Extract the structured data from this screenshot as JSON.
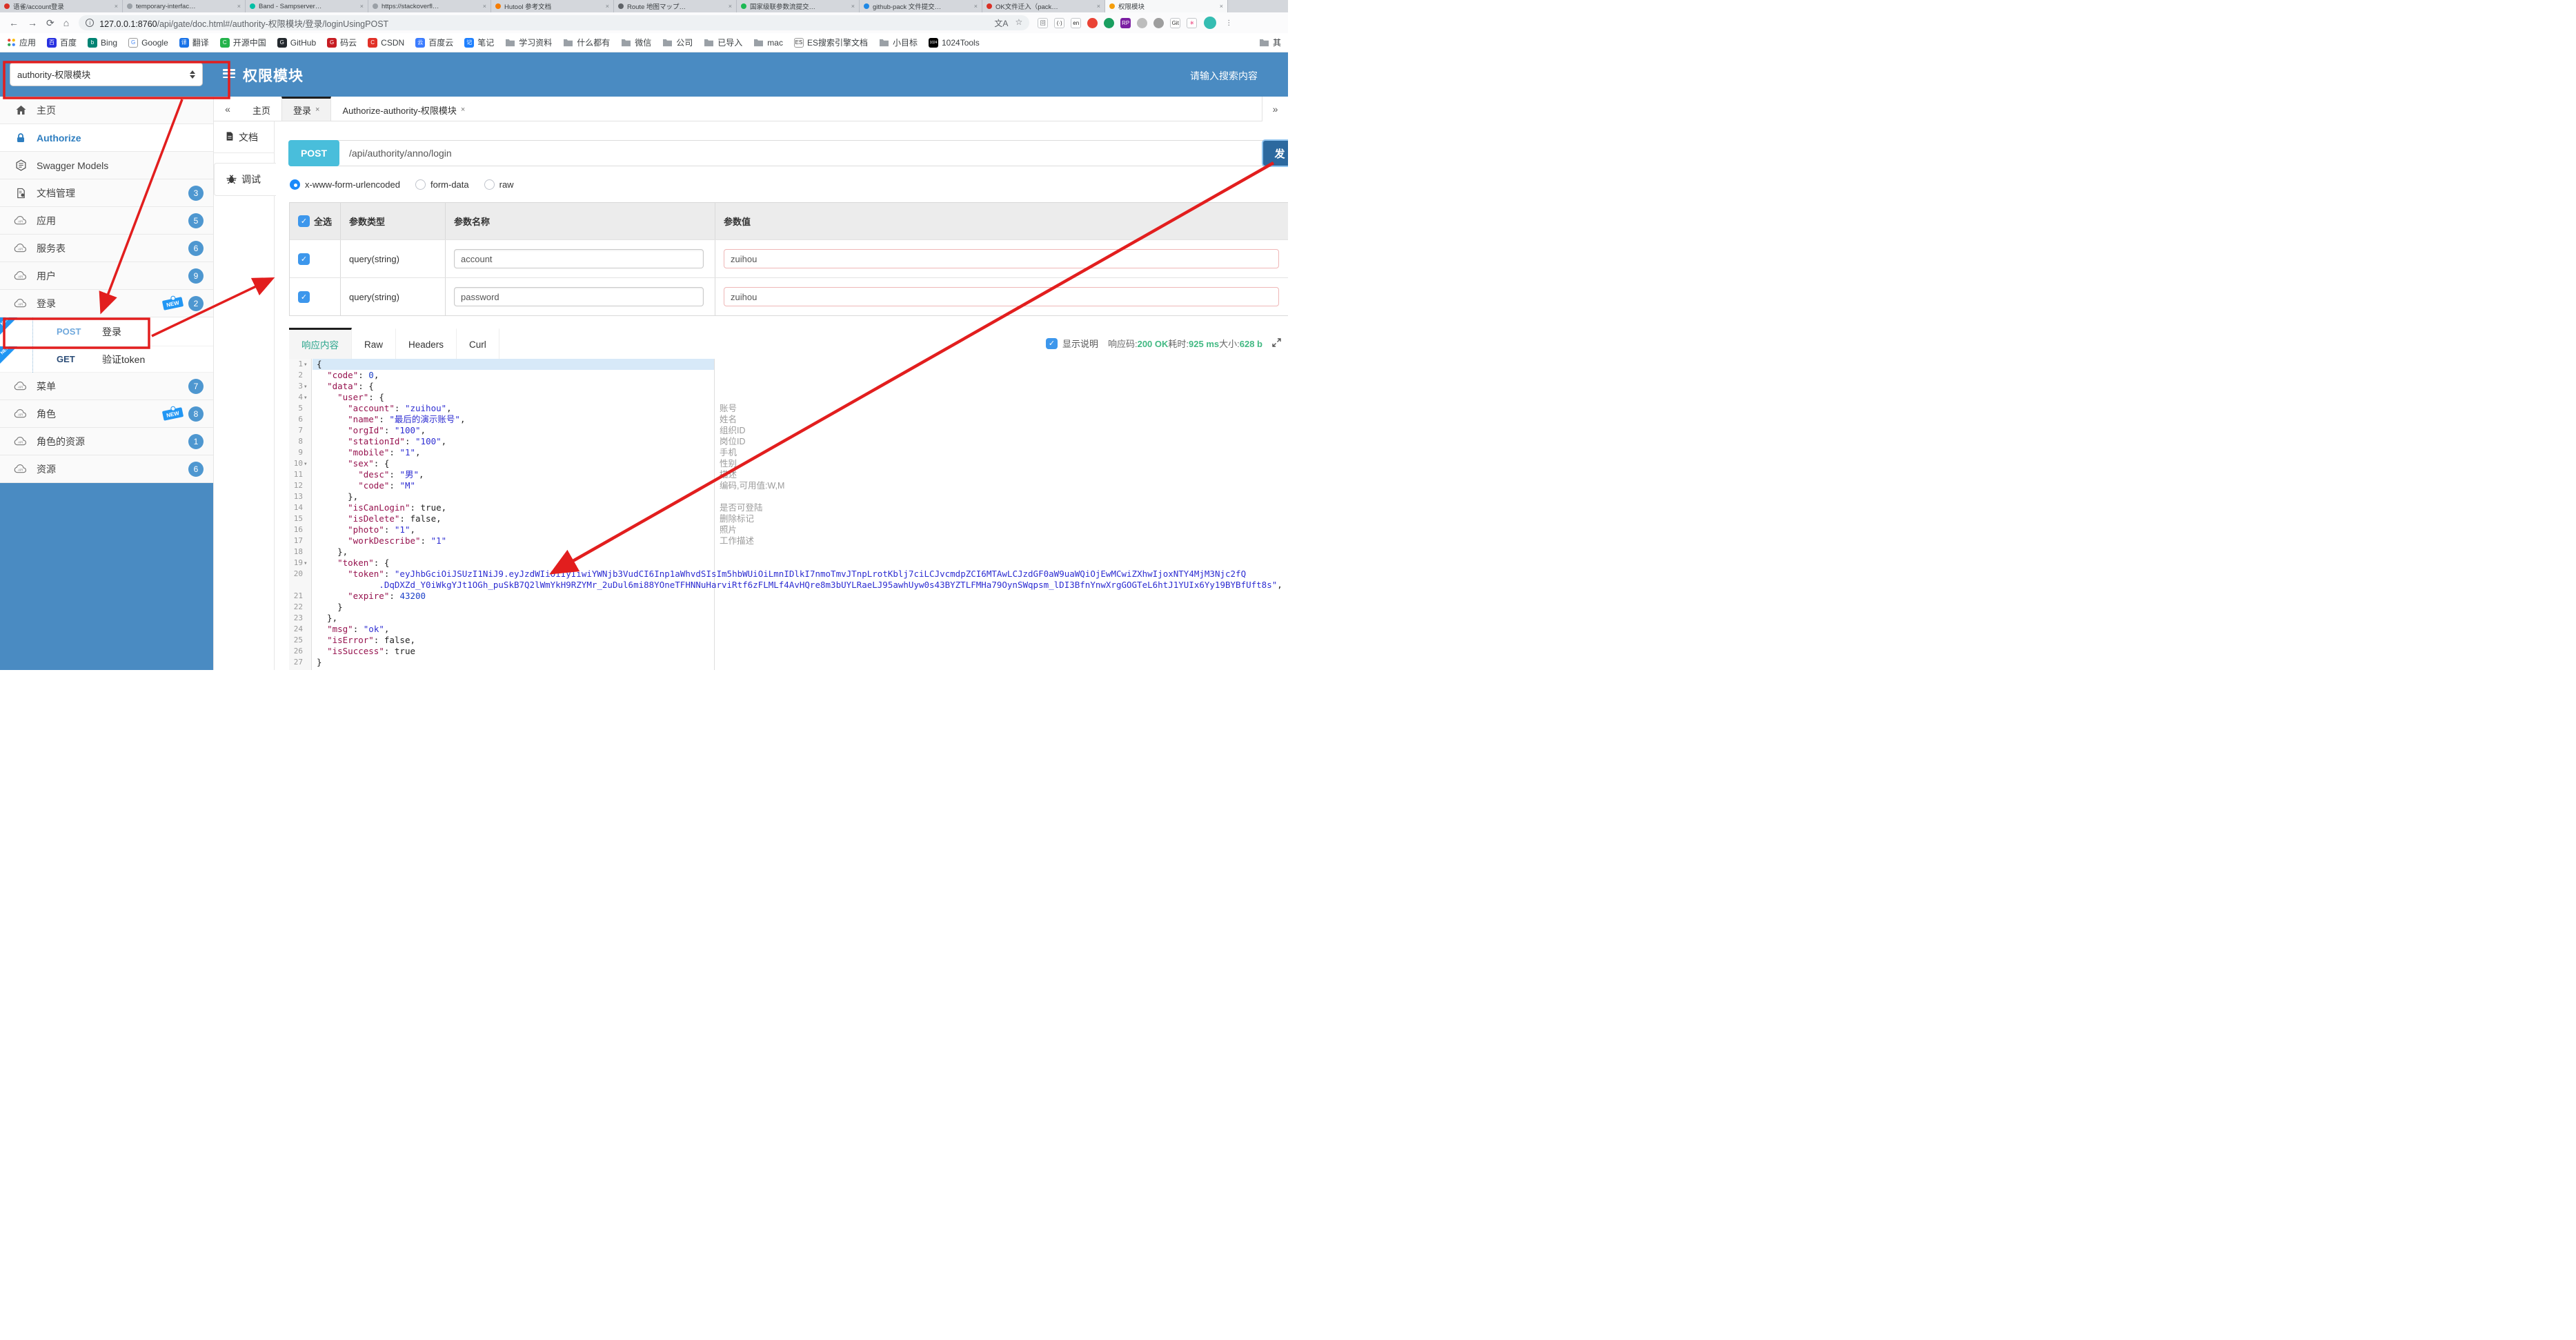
{
  "browser": {
    "tabs": [
      {
        "title": "语雀/account登录",
        "color": "#D93025"
      },
      {
        "title": "temporary-interfac…",
        "color": "#9AA0A6"
      },
      {
        "title": "Band - Sampserver…",
        "color": "#00BFA5"
      },
      {
        "title": "https://stackoverfl…",
        "color": "#9AA0A6"
      },
      {
        "title": "Hutool 参考文档",
        "color": "#F57C00"
      },
      {
        "title": "Route 地图マップ…",
        "color": "#5F6368"
      },
      {
        "title": "国家级联参数流提交…",
        "color": "#1DB954"
      },
      {
        "title": "github-pack 文件提交…",
        "color": "#1E88E5"
      },
      {
        "title": "OK文件迁入（pack…",
        "color": "#D93025"
      },
      {
        "title": "权限模块",
        "color": "#F59E0B",
        "active": true
      }
    ],
    "url_host": "127.0.0.1:8760",
    "url_path": "/api/gate/doc.html#/authority-权限模块/登录/loginUsingPOST",
    "ext_icons": [
      {
        "glyph": "回",
        "bg": "#FFFFFF",
        "fg": "#5F6368"
      },
      {
        "glyph": "(·)",
        "bg": "#FFFFFF",
        "fg": "#333333"
      },
      {
        "glyph": "en",
        "bg": "#FFFFFF",
        "fg": "#222222"
      },
      {
        "glyph": "",
        "bg": "#EA4335",
        "fg": "#FFFFFF"
      },
      {
        "glyph": "",
        "bg": "#1A9F60",
        "fg": "#FFFFFF"
      },
      {
        "glyph": "RP",
        "bg": "#7B1FA2",
        "fg": "#FFFFFF"
      },
      {
        "glyph": "",
        "bg": "#BDBDBD",
        "fg": "#FFFFFF"
      },
      {
        "glyph": "",
        "bg": "#9E9E9E",
        "fg": "#FFFFFF"
      },
      {
        "glyph": "Git",
        "bg": "#FFFFFF",
        "fg": "#333333"
      },
      {
        "glyph": "✳",
        "bg": "#FFFFFF",
        "fg": "#E91E63"
      }
    ],
    "bookmarks": [
      {
        "label": "应用",
        "kind": "apps"
      },
      {
        "label": "百度",
        "kind": "letter",
        "bg": "#2932E1",
        "ch": "百"
      },
      {
        "label": "Bing",
        "kind": "letter",
        "bg": "#008373",
        "ch": "b"
      },
      {
        "label": "Google",
        "kind": "letter",
        "bg": "#FFFFFF",
        "fg": "#4285F4",
        "ch": "G"
      },
      {
        "label": "翻译",
        "kind": "letter",
        "bg": "#1A73E8",
        "ch": "译"
      },
      {
        "label": "开源中国",
        "kind": "letter",
        "bg": "#24B34B",
        "ch": "C"
      },
      {
        "label": "GitHub",
        "kind": "letter",
        "bg": "#24292E",
        "ch": "G"
      },
      {
        "label": "码云",
        "kind": "letter",
        "bg": "#C71D23",
        "ch": "G"
      },
      {
        "label": "CSDN",
        "kind": "letter",
        "bg": "#E13128",
        "ch": "C"
      },
      {
        "label": "百度云",
        "kind": "letter",
        "bg": "#3B7CFF",
        "ch": "云"
      },
      {
        "label": "笔记",
        "kind": "letter",
        "bg": "#1E80FF",
        "ch": "记"
      },
      {
        "label": "学习资料",
        "kind": "folder"
      },
      {
        "label": "什么都有",
        "kind": "folder"
      },
      {
        "label": "微信",
        "kind": "folder"
      },
      {
        "label": "公司",
        "kind": "folder"
      },
      {
        "label": "已导入",
        "kind": "folder"
      },
      {
        "label": "mac",
        "kind": "folder"
      },
      {
        "label": "ES搜索引擎文档",
        "kind": "letter",
        "bg": "#FFFFFF",
        "fg": "#333333",
        "ch": "ES"
      },
      {
        "label": "小目标",
        "kind": "folder"
      },
      {
        "label": "1024Tools",
        "kind": "letter",
        "bg": "#000000",
        "ch": "1024"
      }
    ],
    "bookmark_overflow": "其"
  },
  "header": {
    "module_select": "authority-权限模块",
    "title": "权限模块",
    "search_placeholder": "请输入搜索内容"
  },
  "sidebar": {
    "items": [
      {
        "label": "主页",
        "icon": "home"
      },
      {
        "label": "Authorize",
        "icon": "lock",
        "active": true
      },
      {
        "label": "Swagger Models",
        "icon": "hex"
      },
      {
        "label": "文档管理",
        "icon": "docs",
        "badge": "3"
      },
      {
        "label": "应用",
        "icon": "api",
        "badge": "5"
      },
      {
        "label": "服务表",
        "icon": "api",
        "badge": "6"
      },
      {
        "label": "用户",
        "icon": "api",
        "badge": "9"
      },
      {
        "label": "登录",
        "icon": "api",
        "badge": "2",
        "new": true,
        "children": [
          {
            "method": "POST",
            "label": "登录",
            "new": true
          },
          {
            "method": "GET",
            "label": "验证token",
            "new": true
          }
        ]
      },
      {
        "label": "菜单",
        "icon": "api",
        "badge": "7"
      },
      {
        "label": "角色",
        "icon": "api",
        "badge": "8",
        "new": true
      },
      {
        "label": "角色的资源",
        "icon": "api",
        "badge": "1"
      },
      {
        "label": "资源",
        "icon": "api",
        "badge": "6"
      }
    ]
  },
  "doc_tabs": {
    "collapse": "«",
    "expand": "»",
    "tabs": [
      {
        "label": "主页",
        "closable": false
      },
      {
        "label": "登录",
        "closable": true,
        "active": true
      },
      {
        "label": "Authorize-authority-权限模块",
        "closable": true
      }
    ]
  },
  "subnav": [
    {
      "label": "文档",
      "icon": "doc"
    },
    {
      "label": "调试",
      "icon": "bug",
      "active": true
    }
  ],
  "request": {
    "method": "POST",
    "url": "/api/authority/anno/login",
    "send_label": "发",
    "body_types": [
      {
        "label": "x-www-form-urlencoded",
        "selected": true
      },
      {
        "label": "form-data",
        "selected": false
      },
      {
        "label": "raw",
        "selected": false
      }
    ]
  },
  "params": {
    "headers": [
      "全选",
      "参数类型",
      "参数名称",
      "参数值"
    ],
    "rows": [
      {
        "checked": true,
        "type": "query(string)",
        "name": "account",
        "value": "zuihou"
      },
      {
        "checked": true,
        "type": "query(string)",
        "name": "password",
        "value": "zuihou"
      }
    ]
  },
  "response": {
    "tabs": [
      {
        "label": "响应内容",
        "active": true
      },
      {
        "label": "Raw",
        "active": false
      },
      {
        "label": "Headers",
        "active": false
      },
      {
        "label": "Curl",
        "active": false
      }
    ],
    "show_desc_label": "显示说明",
    "status": {
      "code_label": "响应码:",
      "code": "200 OK",
      "time_label": "耗时:",
      "time": "925 ms",
      "size_label": "大小:",
      "size": "628 b"
    }
  },
  "code": {
    "lines": [
      {
        "n": "1",
        "fold": true,
        "active": true,
        "seg": [
          [
            "p",
            "{"
          ]
        ]
      },
      {
        "n": "2",
        "seg": [
          [
            "p",
            "  "
          ],
          [
            "k",
            "\"code\""
          ],
          [
            "p",
            ": "
          ],
          [
            "n",
            "0"
          ],
          [
            "p",
            ","
          ]
        ]
      },
      {
        "n": "3",
        "fold": true,
        "seg": [
          [
            "p",
            "  "
          ],
          [
            "k",
            "\"data\""
          ],
          [
            "p",
            ": {"
          ]
        ]
      },
      {
        "n": "4",
        "fold": true,
        "seg": [
          [
            "p",
            "    "
          ],
          [
            "k",
            "\"user\""
          ],
          [
            "p",
            ": {"
          ]
        ]
      },
      {
        "n": "5",
        "ann": "账号",
        "seg": [
          [
            "p",
            "      "
          ],
          [
            "k",
            "\"account\""
          ],
          [
            "p",
            ": "
          ],
          [
            "s",
            "\"zuihou\""
          ],
          [
            "p",
            ","
          ]
        ]
      },
      {
        "n": "6",
        "ann": "姓名",
        "seg": [
          [
            "p",
            "      "
          ],
          [
            "k",
            "\"name\""
          ],
          [
            "p",
            ": "
          ],
          [
            "s",
            "\"最后的演示账号\""
          ],
          [
            "p",
            ","
          ]
        ]
      },
      {
        "n": "7",
        "ann": "组织ID",
        "seg": [
          [
            "p",
            "      "
          ],
          [
            "k",
            "\"orgId\""
          ],
          [
            "p",
            ": "
          ],
          [
            "s",
            "\"100\""
          ],
          [
            "p",
            ","
          ]
        ]
      },
      {
        "n": "8",
        "ann": "岗位ID",
        "seg": [
          [
            "p",
            "      "
          ],
          [
            "k",
            "\"stationId\""
          ],
          [
            "p",
            ": "
          ],
          [
            "s",
            "\"100\""
          ],
          [
            "p",
            ","
          ]
        ]
      },
      {
        "n": "9",
        "ann": "手机",
        "seg": [
          [
            "p",
            "      "
          ],
          [
            "k",
            "\"mobile\""
          ],
          [
            "p",
            ": "
          ],
          [
            "s",
            "\"1\""
          ],
          [
            "p",
            ","
          ]
        ]
      },
      {
        "n": "10",
        "fold": true,
        "ann": "性别",
        "seg": [
          [
            "p",
            "      "
          ],
          [
            "k",
            "\"sex\""
          ],
          [
            "p",
            ": {"
          ]
        ]
      },
      {
        "n": "11",
        "ann": "描述",
        "seg": [
          [
            "p",
            "        "
          ],
          [
            "k",
            "\"desc\""
          ],
          [
            "p",
            ": "
          ],
          [
            "s",
            "\"男\""
          ],
          [
            "p",
            ","
          ]
        ]
      },
      {
        "n": "12",
        "ann": "编码,可用值:W,M",
        "seg": [
          [
            "p",
            "        "
          ],
          [
            "k",
            "\"code\""
          ],
          [
            "p",
            ": "
          ],
          [
            "s",
            "\"M\""
          ]
        ]
      },
      {
        "n": "13",
        "seg": [
          [
            "p",
            "      },"
          ]
        ]
      },
      {
        "n": "14",
        "ann": "是否可登陆",
        "seg": [
          [
            "p",
            "      "
          ],
          [
            "k",
            "\"isCanLogin\""
          ],
          [
            "p",
            ": true,"
          ]
        ]
      },
      {
        "n": "15",
        "ann": "删除标记",
        "seg": [
          [
            "p",
            "      "
          ],
          [
            "k",
            "\"isDelete\""
          ],
          [
            "p",
            ": false,"
          ]
        ]
      },
      {
        "n": "16",
        "ann": "照片",
        "seg": [
          [
            "p",
            "      "
          ],
          [
            "k",
            "\"photo\""
          ],
          [
            "p",
            ": "
          ],
          [
            "s",
            "\"1\""
          ],
          [
            "p",
            ","
          ]
        ]
      },
      {
        "n": "17",
        "ann": "工作描述",
        "seg": [
          [
            "p",
            "      "
          ],
          [
            "k",
            "\"workDescribe\""
          ],
          [
            "p",
            ": "
          ],
          [
            "s",
            "\"1\""
          ]
        ]
      },
      {
        "n": "18",
        "seg": [
          [
            "p",
            "    },"
          ]
        ]
      },
      {
        "n": "19",
        "fold": true,
        "seg": [
          [
            "p",
            "    "
          ],
          [
            "k",
            "\"token\""
          ],
          [
            "p",
            ": {"
          ]
        ]
      },
      {
        "n": "20",
        "seg": [
          [
            "p",
            "      "
          ],
          [
            "k",
            "\"token\""
          ],
          [
            "p",
            ": "
          ],
          [
            "s",
            "\"eyJhbGciOiJSUzI1NiJ9.eyJzdWIiOiIyIiwiYWNjb3VudCI6Inp1aWhvdSIsIm5hbWUiOiLmnIDlkI7nmoTmvJTnpLrotKblj7ciLCJvcmdpZCI6MTAwLCJzdGF0aW9uaWQiOjEwMCwiZXhwIjoxNTY4MjM3Njc2fQ"
          ]
        ]
      },
      {
        "n": "",
        "seg": [
          [
            "s",
            "            .DqDXZd_Y0iWkgYJt1OGh_puSkB7Q2lWmYkH9RZYMr_2uDul6mi88YOneTFHNNuHarviRtf6zFLMLf4AvHQre8m3bUYLRaeLJ95awhUyw0s43BYZTLFMHa79OynSWqpsm_lDI3BfnYnwXrgGOGTeL6htJ1YUIx6Yy19BYBfUft8s\""
          ],
          [
            "p",
            ","
          ]
        ]
      },
      {
        "n": "21",
        "seg": [
          [
            "p",
            "      "
          ],
          [
            "k",
            "\"expire\""
          ],
          [
            "p",
            ": "
          ],
          [
            "n",
            "43200"
          ]
        ]
      },
      {
        "n": "22",
        "seg": [
          [
            "p",
            "    }"
          ]
        ]
      },
      {
        "n": "23",
        "seg": [
          [
            "p",
            "  },"
          ]
        ]
      },
      {
        "n": "24",
        "seg": [
          [
            "p",
            "  "
          ],
          [
            "k",
            "\"msg\""
          ],
          [
            "p",
            ": "
          ],
          [
            "s",
            "\"ok\""
          ],
          [
            "p",
            ","
          ]
        ]
      },
      {
        "n": "25",
        "seg": [
          [
            "p",
            "  "
          ],
          [
            "k",
            "\"isError\""
          ],
          [
            "p",
            ": false,"
          ]
        ]
      },
      {
        "n": "26",
        "seg": [
          [
            "p",
            "  "
          ],
          [
            "k",
            "\"isSuccess\""
          ],
          [
            "p",
            ": true"
          ]
        ]
      },
      {
        "n": "27",
        "seg": [
          [
            "p",
            "}"
          ]
        ]
      }
    ]
  },
  "colors": {
    "header_blue": "#4A8BC2",
    "badge_blue": "#4E97D0",
    "new_blue": "#2196F3",
    "post_cyan": "#49BEDB",
    "send_blue": "#2C699F",
    "status_green": "#42B983",
    "annotation_red": "#E21E1E"
  }
}
